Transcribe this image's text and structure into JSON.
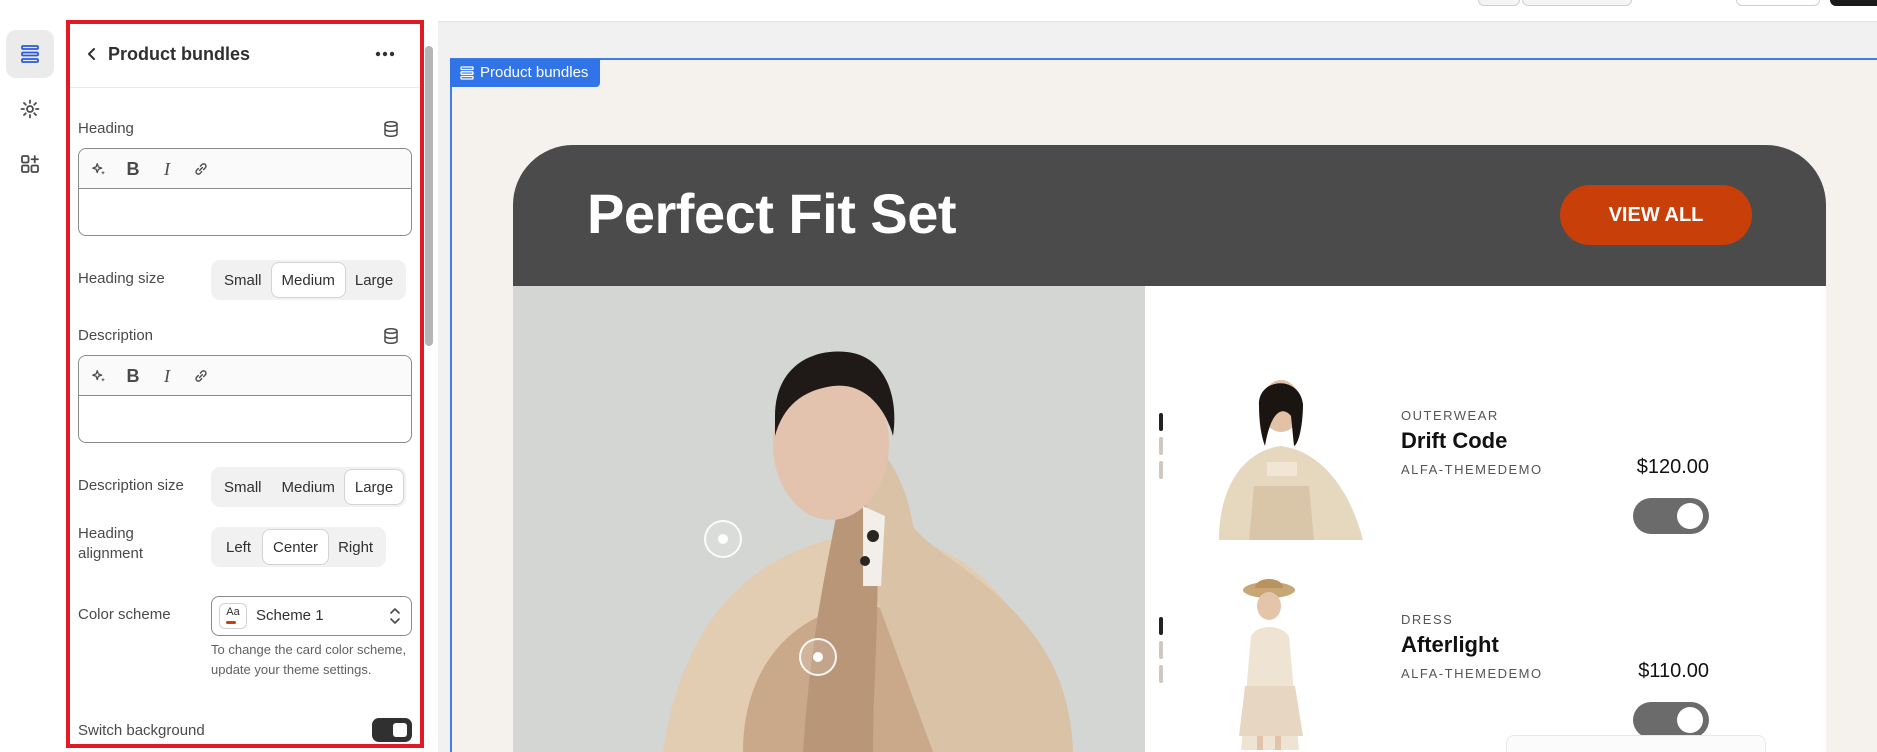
{
  "rail": {
    "items": [
      {
        "icon": "sections-icon",
        "active": true
      },
      {
        "icon": "gear-icon",
        "active": false
      },
      {
        "icon": "apps-add-icon",
        "active": false
      }
    ]
  },
  "panel": {
    "title": "Product bundles",
    "heading_label": "Heading",
    "heading_value": "",
    "heading_size_label": "Heading size",
    "heading_size_options": [
      "Small",
      "Medium",
      "Large"
    ],
    "heading_size_selected": "Medium",
    "description_label": "Description",
    "description_value": "",
    "description_size_label": "Description size",
    "description_size_options": [
      "Small",
      "Medium",
      "Large"
    ],
    "description_size_selected": "Large",
    "heading_alignment_label": "Heading alignment",
    "heading_alignment_options": [
      "Left",
      "Center",
      "Right"
    ],
    "heading_alignment_selected": "Center",
    "color_scheme_label": "Color scheme",
    "color_scheme_value": "Scheme 1",
    "color_scheme_chip": "Aa",
    "color_scheme_help": "To change the card color scheme, update your theme settings.",
    "switch_background_label": "Switch background",
    "switch_background_on": true,
    "rte_tools": [
      "magic-icon",
      "bold-icon",
      "italic-icon",
      "link-icon"
    ]
  },
  "preview": {
    "section_tag": "Product bundles",
    "bundle_title": "Perfect Fit Set",
    "view_all_label": "VIEW ALL",
    "products": [
      {
        "category": "OUTERWEAR",
        "name": "Drift Code",
        "vendor": "ALFA-THEMEDEMO",
        "price": "$120.00",
        "selected": true
      },
      {
        "category": "DRESS",
        "name": "Afterlight",
        "vendor": "ALFA-THEMEDEMO",
        "price": "$110.00",
        "selected": true
      }
    ]
  },
  "colors": {
    "accent_blue": "#3174e8",
    "cta_orange": "#c93f0a",
    "header_gray": "#4b4b4b",
    "highlight_red": "#e01b24"
  }
}
